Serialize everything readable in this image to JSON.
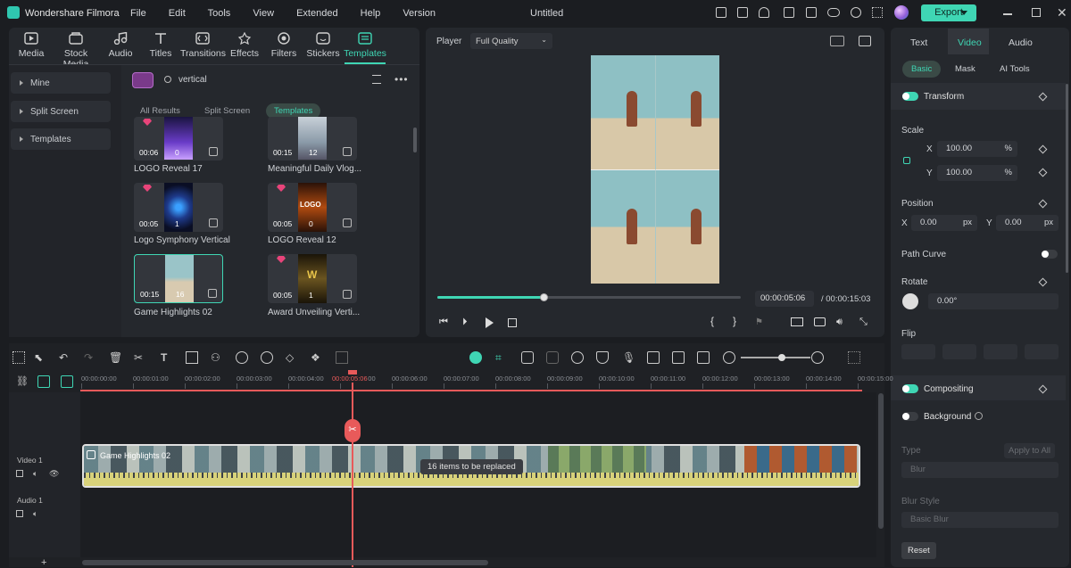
{
  "app": {
    "name": "Wondershare Filmora",
    "document_title": "Untitled",
    "export_label": "Export"
  },
  "menu": [
    "File",
    "Edit",
    "Tools",
    "View",
    "Extended",
    "Help",
    "Version"
  ],
  "toolbar": [
    {
      "label": "Media",
      "icon": "media-icon"
    },
    {
      "label": "Stock Media",
      "icon": "stock-media-icon"
    },
    {
      "label": "Audio",
      "icon": "audio-icon"
    },
    {
      "label": "Titles",
      "icon": "titles-icon"
    },
    {
      "label": "Transitions",
      "icon": "transitions-icon"
    },
    {
      "label": "Effects",
      "icon": "effects-icon"
    },
    {
      "label": "Filters",
      "icon": "filters-icon"
    },
    {
      "label": "Stickers",
      "icon": "stickers-icon"
    },
    {
      "label": "Templates",
      "icon": "templates-icon",
      "active": true
    }
  ],
  "sidebar": [
    "Mine",
    "Split Screen",
    "Templates"
  ],
  "search": {
    "value": "vertical"
  },
  "filter_tabs": [
    "All Results",
    "Split Screen",
    "Templates"
  ],
  "templates": [
    {
      "title": "LOGO Reveal 17",
      "duration": "00:06",
      "count": "0",
      "thumb_color": "#6a3cc8"
    },
    {
      "title": "Meaningful Daily Vlog...",
      "duration": "00:15",
      "count": "12",
      "thumb_color": "#8a9aa8"
    },
    {
      "title": "Logo Symphony Vertical",
      "duration": "00:05",
      "count": "1",
      "thumb_color": "#1e3a8a"
    },
    {
      "title": "LOGO Reveal 12",
      "duration": "00:05",
      "count": "0",
      "thumb_color": "#b04a10",
      "thumb_text": "LOGO"
    },
    {
      "title": "Game Highlights 02",
      "duration": "00:15",
      "count": "16",
      "thumb_color": "#c4b8a0"
    },
    {
      "title": "Award Unveiling Verti...",
      "duration": "00:05",
      "count": "1",
      "thumb_color": "#6a5420",
      "thumb_text": "W"
    }
  ],
  "player": {
    "label": "Player",
    "quality": "Full Quality",
    "current_time": "00:00:05:06",
    "total_time": "/ 00:00:15:03",
    "progress": 0.35
  },
  "right_panel": {
    "tabs": [
      "Text",
      "Video",
      "Audio"
    ],
    "subtabs": [
      "Basic",
      "Mask",
      "AI Tools"
    ],
    "transform": "Transform",
    "scale": "Scale",
    "scale_x": "100.00",
    "scale_y": "100.00",
    "percent": "%",
    "x_label": "X",
    "y_label": "Y",
    "position": "Position",
    "pos_x": "0.00",
    "pos_y": "0.00",
    "px": "px",
    "path_curve": "Path Curve",
    "rotate": "Rotate",
    "rotate_value": "0.00°",
    "flip": "Flip",
    "compositing": "Compositing",
    "background": "Background",
    "type": "Type",
    "apply_all": "Apply to All",
    "type_value": "Blur",
    "blur_style": "Blur Style",
    "blur_style_value": "Basic Blur",
    "reset": "Reset"
  },
  "timeline": {
    "ticks": [
      "00:00:00:00",
      "00:00:01:00",
      "00:00:02:00",
      "00:00:03:00",
      "00:00:04:00",
      "00:00:05:00",
      "00:00:06:00",
      "00:00:07:00",
      "00:00:08:00",
      "00:00:09:00",
      "00:00:10:00",
      "00:00:11:00",
      "00:00:12:00",
      "00:00:13:00",
      "00:00:14:00",
      "00:00:15:00"
    ],
    "video_track": "Video 1",
    "audio_track": "Audio 1",
    "clip_title": "Game Highlights 02",
    "tooltip": "16 items to be replaced",
    "playhead_time": "00:00:05:06"
  },
  "colors": {
    "accent": "#3fd6b4",
    "playhead": "#e85a5a",
    "gem": "#e8447a",
    "clip_border": "#e0e0e0",
    "waveform": "#d8d27a"
  }
}
